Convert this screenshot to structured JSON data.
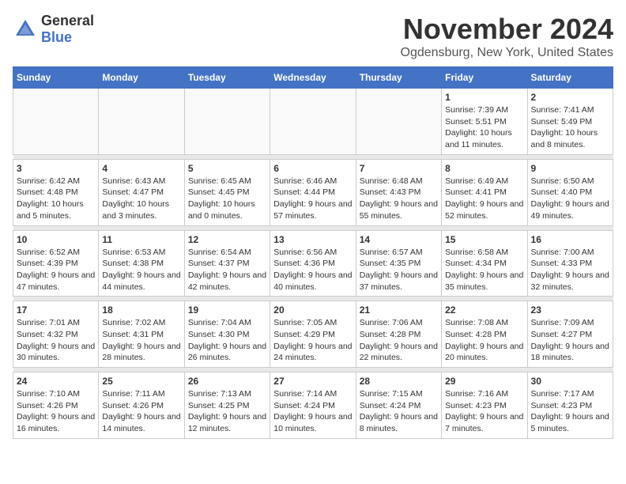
{
  "logo": {
    "general": "General",
    "blue": "Blue"
  },
  "header": {
    "month": "November 2024",
    "location": "Ogdensburg, New York, United States"
  },
  "weekdays": [
    "Sunday",
    "Monday",
    "Tuesday",
    "Wednesday",
    "Thursday",
    "Friday",
    "Saturday"
  ],
  "weeks": [
    [
      {
        "day": "",
        "info": ""
      },
      {
        "day": "",
        "info": ""
      },
      {
        "day": "",
        "info": ""
      },
      {
        "day": "",
        "info": ""
      },
      {
        "day": "",
        "info": ""
      },
      {
        "day": "1",
        "info": "Sunrise: 7:39 AM\nSunset: 5:51 PM\nDaylight: 10 hours and 11 minutes."
      },
      {
        "day": "2",
        "info": "Sunrise: 7:41 AM\nSunset: 5:49 PM\nDaylight: 10 hours and 8 minutes."
      }
    ],
    [
      {
        "day": "3",
        "info": "Sunrise: 6:42 AM\nSunset: 4:48 PM\nDaylight: 10 hours and 5 minutes."
      },
      {
        "day": "4",
        "info": "Sunrise: 6:43 AM\nSunset: 4:47 PM\nDaylight: 10 hours and 3 minutes."
      },
      {
        "day": "5",
        "info": "Sunrise: 6:45 AM\nSunset: 4:45 PM\nDaylight: 10 hours and 0 minutes."
      },
      {
        "day": "6",
        "info": "Sunrise: 6:46 AM\nSunset: 4:44 PM\nDaylight: 9 hours and 57 minutes."
      },
      {
        "day": "7",
        "info": "Sunrise: 6:48 AM\nSunset: 4:43 PM\nDaylight: 9 hours and 55 minutes."
      },
      {
        "day": "8",
        "info": "Sunrise: 6:49 AM\nSunset: 4:41 PM\nDaylight: 9 hours and 52 minutes."
      },
      {
        "day": "9",
        "info": "Sunrise: 6:50 AM\nSunset: 4:40 PM\nDaylight: 9 hours and 49 minutes."
      }
    ],
    [
      {
        "day": "10",
        "info": "Sunrise: 6:52 AM\nSunset: 4:39 PM\nDaylight: 9 hours and 47 minutes."
      },
      {
        "day": "11",
        "info": "Sunrise: 6:53 AM\nSunset: 4:38 PM\nDaylight: 9 hours and 44 minutes."
      },
      {
        "day": "12",
        "info": "Sunrise: 6:54 AM\nSunset: 4:37 PM\nDaylight: 9 hours and 42 minutes."
      },
      {
        "day": "13",
        "info": "Sunrise: 6:56 AM\nSunset: 4:36 PM\nDaylight: 9 hours and 40 minutes."
      },
      {
        "day": "14",
        "info": "Sunrise: 6:57 AM\nSunset: 4:35 PM\nDaylight: 9 hours and 37 minutes."
      },
      {
        "day": "15",
        "info": "Sunrise: 6:58 AM\nSunset: 4:34 PM\nDaylight: 9 hours and 35 minutes."
      },
      {
        "day": "16",
        "info": "Sunrise: 7:00 AM\nSunset: 4:33 PM\nDaylight: 9 hours and 32 minutes."
      }
    ],
    [
      {
        "day": "17",
        "info": "Sunrise: 7:01 AM\nSunset: 4:32 PM\nDaylight: 9 hours and 30 minutes."
      },
      {
        "day": "18",
        "info": "Sunrise: 7:02 AM\nSunset: 4:31 PM\nDaylight: 9 hours and 28 minutes."
      },
      {
        "day": "19",
        "info": "Sunrise: 7:04 AM\nSunset: 4:30 PM\nDaylight: 9 hours and 26 minutes."
      },
      {
        "day": "20",
        "info": "Sunrise: 7:05 AM\nSunset: 4:29 PM\nDaylight: 9 hours and 24 minutes."
      },
      {
        "day": "21",
        "info": "Sunrise: 7:06 AM\nSunset: 4:28 PM\nDaylight: 9 hours and 22 minutes."
      },
      {
        "day": "22",
        "info": "Sunrise: 7:08 AM\nSunset: 4:28 PM\nDaylight: 9 hours and 20 minutes."
      },
      {
        "day": "23",
        "info": "Sunrise: 7:09 AM\nSunset: 4:27 PM\nDaylight: 9 hours and 18 minutes."
      }
    ],
    [
      {
        "day": "24",
        "info": "Sunrise: 7:10 AM\nSunset: 4:26 PM\nDaylight: 9 hours and 16 minutes."
      },
      {
        "day": "25",
        "info": "Sunrise: 7:11 AM\nSunset: 4:26 PM\nDaylight: 9 hours and 14 minutes."
      },
      {
        "day": "26",
        "info": "Sunrise: 7:13 AM\nSunset: 4:25 PM\nDaylight: 9 hours and 12 minutes."
      },
      {
        "day": "27",
        "info": "Sunrise: 7:14 AM\nSunset: 4:24 PM\nDaylight: 9 hours and 10 minutes."
      },
      {
        "day": "28",
        "info": "Sunrise: 7:15 AM\nSunset: 4:24 PM\nDaylight: 9 hours and 8 minutes."
      },
      {
        "day": "29",
        "info": "Sunrise: 7:16 AM\nSunset: 4:23 PM\nDaylight: 9 hours and 7 minutes."
      },
      {
        "day": "30",
        "info": "Sunrise: 7:17 AM\nSunset: 4:23 PM\nDaylight: 9 hours and 5 minutes."
      }
    ]
  ]
}
